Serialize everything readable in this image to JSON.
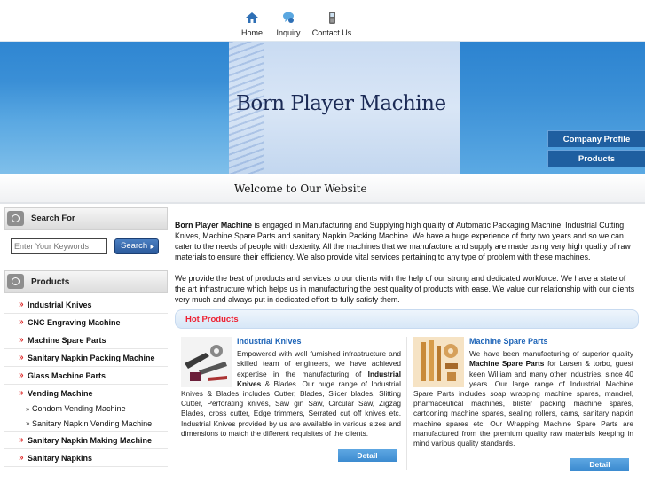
{
  "nav": {
    "items": [
      {
        "label": "Home",
        "icon": "home-icon"
      },
      {
        "label": "Inquiry",
        "icon": "inquiry-icon"
      },
      {
        "label": "Contact Us",
        "icon": "phone-icon"
      }
    ]
  },
  "banner": {
    "brand": "Born Player Machine",
    "buttons": [
      "Company Profile",
      "Products"
    ]
  },
  "welcome": "Welcome to Our Website",
  "search": {
    "title": "Search For",
    "placeholder": "Enter Your Keywords",
    "button": "Search"
  },
  "products": {
    "title": "Products",
    "items": [
      "Industrial Knives",
      "CNC Engraving Machine",
      "Machine Spare Parts",
      "Sanitary Napkin Packing Machine",
      "Glass Machine Parts",
      "Vending Machine",
      "Condom Vending Machine",
      "Sanitary Napkin Vending Machine",
      "Sanitary Napkin Making Machine",
      "Sanitary Napkins"
    ]
  },
  "intro": {
    "p1_bold": "Born Player Machine",
    "p1_rest": " is engaged in Manufacturing and Supplying high quality of Automatic Packaging Machine, Industrial Cutting Knives, Machine Spare Parts and sanitary Napkin Packing Machine. We have a huge experience of forty two years and so we can cater to the needs of people with dexterity. All the machines that we manufacture and supply are made using very high quality of raw materials to ensure their efficiency. We also provide vital services pertaining to any type of problem with these machines.",
    "p2": "We provide the best of products and services to our clients with the help of our strong and dedicated workforce. We have a state of the art infrastructure which helps us in manufacturing the best quality of products with ease. We value our relationship with our clients very much and always put in dedicated effort to fully satisfy them."
  },
  "hot": {
    "title": "Hot Products",
    "cards": [
      {
        "title": "Industrial Knives",
        "desc_a": "Empowered with well furnished infrastructure and skilled team of engineers, we have achieved expertise in the manufacturing of ",
        "desc_bold": "Industrial Knives",
        "desc_b": " & Blades. Our huge range of Industrial Knives & Blades includes Cutter, Blades, Slicer blades, Slitting Cutter, Perforating knives, Saw gin Saw, Circular Saw, Zigzag Blades, cross cutter, Edge trimmers, Serrated cut off knives etc. Industrial Knives provided by us are available in various sizes and dimensions to match the different requisites of the clients.",
        "button": "Detail"
      },
      {
        "title": "Machine Spare Parts",
        "desc_a": "We have been manufacturing of superior quality ",
        "desc_bold": "Machine Spare Parts",
        "desc_b": " for Larsen & torbo, guest keen William and many other industries, since 40 years. Our large range of Industrial Machine Spare Parts includes soap wrapping machine spares, mandrel, pharmaceutical machines, blister packing machine spares, cartooning machine spares, sealing rollers, cams, sanitary napkin machine spares etc. Our Wrapping Machine Spare Parts are manufactured from the premium quality raw materials keeping in mind various quality standards.",
        "button": "Detail"
      }
    ]
  },
  "colors": {
    "banner_blue": "#3a8fd6",
    "sidebar_button": "#1f5fa0",
    "link_blue": "#1c63b7",
    "hot_red": "#e22233",
    "bullet_red": "#dd2222"
  }
}
